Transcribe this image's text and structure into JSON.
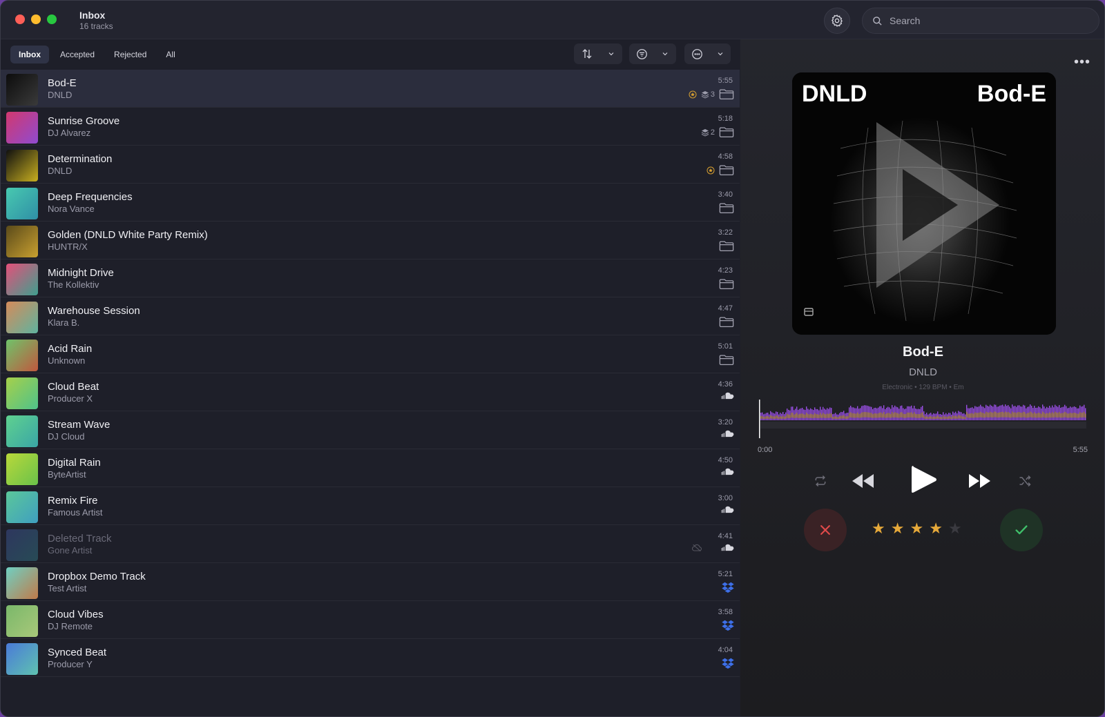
{
  "window": {
    "title": "Inbox",
    "subtitle": "16 tracks"
  },
  "search": {
    "placeholder": "Search"
  },
  "tabs": [
    {
      "label": "Inbox",
      "active": true
    },
    {
      "label": "Accepted",
      "active": false
    },
    {
      "label": "Rejected",
      "active": false
    },
    {
      "label": "All",
      "active": false
    }
  ],
  "tracks": [
    {
      "title": "Bod-E",
      "artist": "DNLD",
      "duration": "5:55",
      "source": "folder",
      "starred": true,
      "versions": "3",
      "selected": true
    },
    {
      "title": "Sunrise Groove",
      "artist": "DJ Alvarez",
      "duration": "5:18",
      "source": "folder",
      "versions": "2"
    },
    {
      "title": "Determination",
      "artist": "DNLD",
      "duration": "4:58",
      "source": "folder",
      "starred": true
    },
    {
      "title": "Deep Frequencies",
      "artist": "Nora Vance",
      "duration": "3:40",
      "source": "folder"
    },
    {
      "title": "Golden (DNLD White Party Remix)",
      "artist": "HUNTR/X",
      "duration": "3:22",
      "source": "folder"
    },
    {
      "title": "Midnight Drive",
      "artist": "The Kollektiv",
      "duration": "4:23",
      "source": "folder"
    },
    {
      "title": "Warehouse Session",
      "artist": "Klara B.",
      "duration": "4:47",
      "source": "folder"
    },
    {
      "title": "Acid Rain",
      "artist": "Unknown",
      "duration": "5:01",
      "source": "folder"
    },
    {
      "title": "Cloud Beat",
      "artist": "Producer X",
      "duration": "4:36",
      "source": "soundcloud"
    },
    {
      "title": "Stream Wave",
      "artist": "DJ Cloud",
      "duration": "3:20",
      "source": "soundcloud"
    },
    {
      "title": "Digital Rain",
      "artist": "ByteArtist",
      "duration": "4:50",
      "source": "soundcloud"
    },
    {
      "title": "Remix Fire",
      "artist": "Famous Artist",
      "duration": "3:00",
      "source": "soundcloud"
    },
    {
      "title": "Deleted Track",
      "artist": "Gone Artist",
      "duration": "4:41",
      "source": "soundcloud",
      "unavailable": true
    },
    {
      "title": "Dropbox Demo Track",
      "artist": "Test Artist",
      "duration": "5:21",
      "source": "dropbox"
    },
    {
      "title": "Cloud Vibes",
      "artist": "DJ Remote",
      "duration": "3:58",
      "source": "dropbox"
    },
    {
      "title": "Synced Beat",
      "artist": "Producer Y",
      "duration": "4:04",
      "source": "dropbox"
    }
  ],
  "thumb_colors": [
    [
      "#0c0c0c",
      "#3a3a3a"
    ],
    [
      "#d2386e",
      "#8f4bd0"
    ],
    [
      "#101010",
      "#c9b020"
    ],
    [
      "#48c9b0",
      "#2f8fa6"
    ],
    [
      "#5a4a1a",
      "#c9a030"
    ],
    [
      "#e4507a",
      "#3f9f8e"
    ],
    [
      "#d58b5a",
      "#5fb39f"
    ],
    [
      "#6fc36a",
      "#c0583e"
    ],
    [
      "#a6d04a",
      "#4fc28a"
    ],
    [
      "#5fd18f",
      "#3aa6a6"
    ],
    [
      "#b9d83a",
      "#6ac24a"
    ],
    [
      "#5bc79a",
      "#3f9fc0"
    ],
    [
      "#3b4a8a",
      "#2f6f7a"
    ],
    [
      "#6fd0c2",
      "#c07a4a"
    ],
    [
      "#7ab86a",
      "#a8c87a"
    ],
    [
      "#4a7ad8",
      "#5fc2b0"
    ]
  ],
  "now_playing": {
    "title": "Bod-E",
    "artist": "DNLD",
    "meta": "Electronic • 129 BPM • Em",
    "art_logo": "DNLD",
    "art_title": "Bod-E",
    "time_start": "0:00",
    "time_end": "5:55",
    "rating": 4,
    "rating_max": 5,
    "progress": 0
  },
  "colors": {
    "accent_purple": "#9b4fe6",
    "star": "#e6a93a",
    "reject": "#e04a4a",
    "accept": "#3fbf6a",
    "dropbox": "#3d6fe8"
  }
}
